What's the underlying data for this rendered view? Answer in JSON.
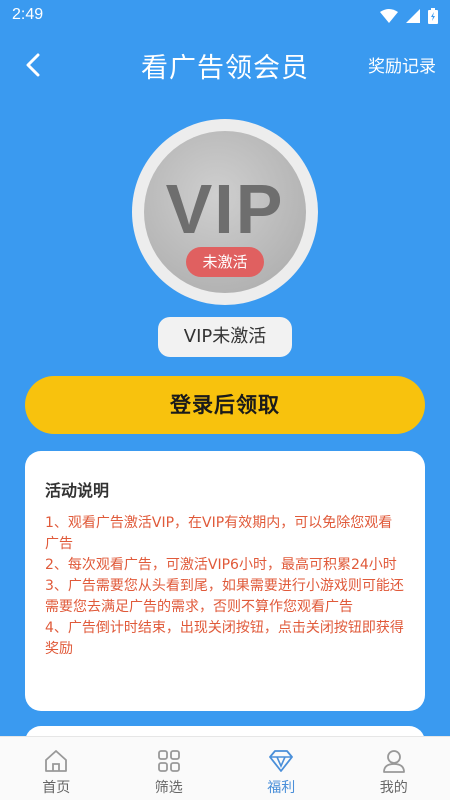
{
  "status_bar": {
    "time": "2:49"
  },
  "header": {
    "title": "看广告领会员",
    "reward_link": "奖励记录"
  },
  "vip": {
    "badge_text": "VIP",
    "inactive_label": "未激活",
    "status_chip": "VIP未激活"
  },
  "actions": {
    "login_button": "登录后领取"
  },
  "activity": {
    "title": "活动说明",
    "rules": [
      "1、观看广告激活VIP，在VIP有效期内，可以免除您观看广告",
      "2、每次观看广告，可激活VIP6小时，最高可积累24小时",
      "3、广告需要您从头看到尾，如果需要进行小游戏则可能还需要您去满足广告的需求，否则不算作您观看广告",
      "4、广告倒计时结束，出现关闭按钮，点击关闭按钮即获得奖励"
    ]
  },
  "bottom_nav": {
    "items": [
      {
        "label": "首页",
        "icon": "home-icon"
      },
      {
        "label": "筛选",
        "icon": "grid-icon"
      },
      {
        "label": "福利",
        "icon": "diamond-icon",
        "active": true
      },
      {
        "label": "我的",
        "icon": "user-icon"
      }
    ]
  },
  "colors": {
    "background": "#3a9af0",
    "accent_button": "#f8c20d",
    "inactive_badge": "#e06060",
    "rules_text": "#e05a3a",
    "nav_active": "#4a8fd9"
  }
}
